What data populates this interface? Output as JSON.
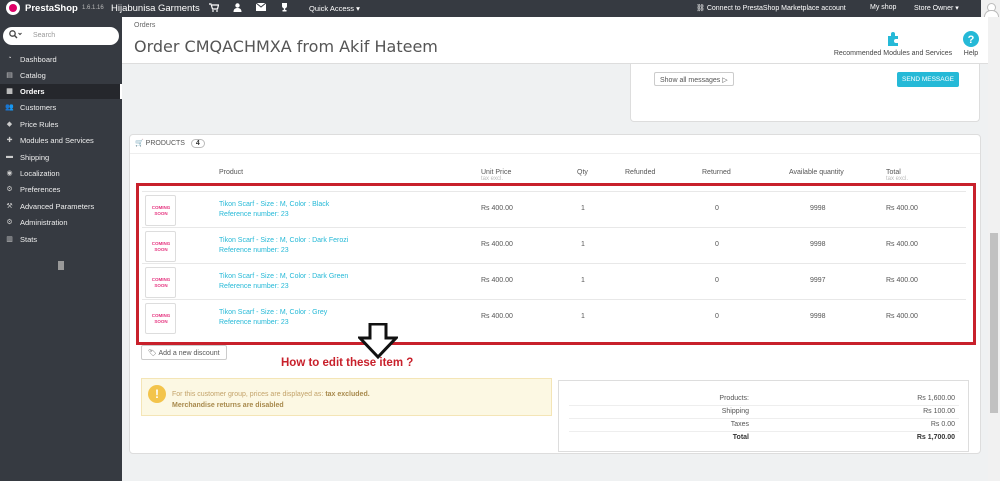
{
  "topbar": {
    "brand_presta": "Presta",
    "brand_shop": "Shop",
    "version": "1.6.1.16",
    "shop_name": "Hijabunisa Garments",
    "quick_access": "Quick Access ▾",
    "connect": "Connect to PrestaShop Marketplace account",
    "my_shop": "My shop",
    "store_owner": "Store Owner ▾"
  },
  "sidebar": {
    "search_placeholder": "Search",
    "items": [
      {
        "label": "Dashboard",
        "icon": "dashboard-icon"
      },
      {
        "label": "Catalog",
        "icon": "catalog-icon"
      },
      {
        "label": "Orders",
        "icon": "orders-icon"
      },
      {
        "label": "Customers",
        "icon": "customers-icon"
      },
      {
        "label": "Price Rules",
        "icon": "price-rules-icon"
      },
      {
        "label": "Modules and Services",
        "icon": "modules-icon"
      },
      {
        "label": "Shipping",
        "icon": "shipping-icon"
      },
      {
        "label": "Localization",
        "icon": "localization-icon"
      },
      {
        "label": "Preferences",
        "icon": "preferences-icon"
      },
      {
        "label": "Advanced Parameters",
        "icon": "advanced-parameters-icon"
      },
      {
        "label": "Administration",
        "icon": "administration-icon"
      },
      {
        "label": "Stats",
        "icon": "stats-icon"
      }
    ]
  },
  "header": {
    "breadcrumb": "Orders",
    "title": "Order CMQACHMXA from Akif Hateem",
    "recommended": "Recommended Modules and Services",
    "help": "Help"
  },
  "messages": {
    "show_all": "Show all messages ▷",
    "send": "SEND MESSAGE"
  },
  "products": {
    "heading": "PRODUCTS",
    "count": "4",
    "columns": {
      "product": "Product",
      "unit_price": "Unit Price",
      "unit_price_sub": "tax excl.",
      "qty": "Qty",
      "refunded": "Refunded",
      "returned": "Returned",
      "available": "Available quantity",
      "total": "Total",
      "total_sub": "tax excl."
    },
    "image_text": "COMING SOON",
    "rows": [
      {
        "name": "Tikon Scarf - Size : M, Color : Black",
        "ref": "Reference number: 23",
        "price": "Rs 400.00",
        "qty": "1",
        "returned": "0",
        "available": "9998",
        "total": "Rs 400.00"
      },
      {
        "name": "Tikon Scarf - Size : M, Color : Dark Ferozi",
        "ref": "Reference number: 23",
        "price": "Rs 400.00",
        "qty": "1",
        "returned": "0",
        "available": "9998",
        "total": "Rs 400.00"
      },
      {
        "name": "Tikon Scarf - Size : M, Color : Dark Green",
        "ref": "Reference number: 23",
        "price": "Rs 400.00",
        "qty": "1",
        "returned": "0",
        "available": "9997",
        "total": "Rs 400.00"
      },
      {
        "name": "Tikon Scarf - Size : M, Color : Grey",
        "ref": "Reference number: 23",
        "price": "Rs 400.00",
        "qty": "1",
        "returned": "0",
        "available": "9998",
        "total": "Rs 400.00"
      }
    ],
    "add_discount": "Add a new discount"
  },
  "annotation": {
    "question": "How to edit these item ?"
  },
  "alert": {
    "line1_prefix": "For this customer group, prices are displayed as:",
    "line1_strong": "tax excluded.",
    "line2": "Merchandise returns are disabled"
  },
  "totals": [
    {
      "label": "Products:",
      "value": "Rs 1,600.00"
    },
    {
      "label": "Shipping",
      "value": "Rs 100.00"
    },
    {
      "label": "Taxes",
      "value": "Rs 0.00"
    },
    {
      "label": "Total",
      "value": "Rs 1,700.00"
    }
  ],
  "colors": {
    "topbar": "#363a41",
    "accent": "#25b9d7",
    "highlight": "#c8202b"
  }
}
